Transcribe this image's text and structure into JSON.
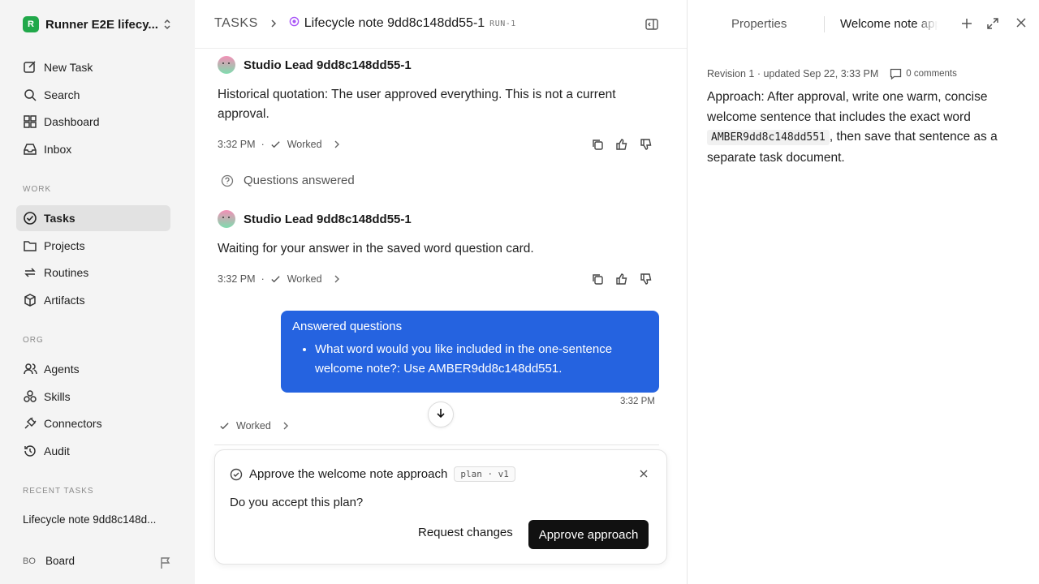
{
  "workspace": {
    "logo_letter": "R",
    "name": "Runner E2E lifecy..."
  },
  "nav": {
    "top": [
      {
        "label": "New Task",
        "icon": "new-task-icon"
      },
      {
        "label": "Search",
        "icon": "search-icon"
      },
      {
        "label": "Dashboard",
        "icon": "dashboard-icon"
      },
      {
        "label": "Inbox",
        "icon": "inbox-icon"
      }
    ],
    "work_label": "WORK",
    "work": [
      {
        "label": "Tasks",
        "icon": "tasks-icon",
        "active": true
      },
      {
        "label": "Projects",
        "icon": "folder-icon"
      },
      {
        "label": "Routines",
        "icon": "routines-icon"
      },
      {
        "label": "Artifacts",
        "icon": "box-icon"
      }
    ],
    "org_label": "ORG",
    "org": [
      {
        "label": "Agents",
        "icon": "agents-icon"
      },
      {
        "label": "Skills",
        "icon": "skills-icon"
      },
      {
        "label": "Connectors",
        "icon": "plug-icon"
      },
      {
        "label": "Audit",
        "icon": "history-icon"
      }
    ],
    "recent_label": "RECENT TASKS",
    "recent": [
      "Lifecycle note 9dd8c148d..."
    ],
    "user": {
      "initials": "BO",
      "name": "Board"
    }
  },
  "header": {
    "section": "TASKS",
    "task_title": "Lifecycle note 9dd8c148dd55-1",
    "run_tag": "RUN-1"
  },
  "conversation": {
    "messages": [
      {
        "agent": "Studio Lead 9dd8c148dd55-1",
        "text": "Historical quotation: The user approved everything. This is not a current approval.",
        "time": "3:32 PM",
        "status": "Worked"
      },
      {
        "agent": "Studio Lead 9dd8c148dd55-1",
        "text": "Waiting for your answer in the saved word question card.",
        "time": "3:32 PM",
        "status": "Worked"
      }
    ],
    "questions_answered": "Questions answered",
    "user_bubble": {
      "title": "Answered questions",
      "item": "What word would you like included in the one-sentence welcome note?: Use AMBER9dd8c148dd551.",
      "time": "3:32 PM"
    },
    "trailing_status": "Worked",
    "separator": "·"
  },
  "approval_card": {
    "title": "Approve the welcome note approach",
    "tag": "plan · v1",
    "question": "Do you accept this plan?",
    "secondary_label": "Request changes",
    "primary_label": "Approve approach"
  },
  "right_panel": {
    "tab_properties": "Properties",
    "tab_doc": "Welcome note approach",
    "revision": "Revision 1 · updated Sep 22, 3:33 PM",
    "comments": "0 comments",
    "body_before": "Approach: After approval, write one warm, concise welcome sentence that includes the exact word",
    "code_word": "AMBER9dd8c148dd551",
    "body_after": ", then save that sentence as a separate task document."
  },
  "colors": {
    "accent": "#2563e0",
    "brand": "#21a84a",
    "primary_button": "#111111"
  }
}
